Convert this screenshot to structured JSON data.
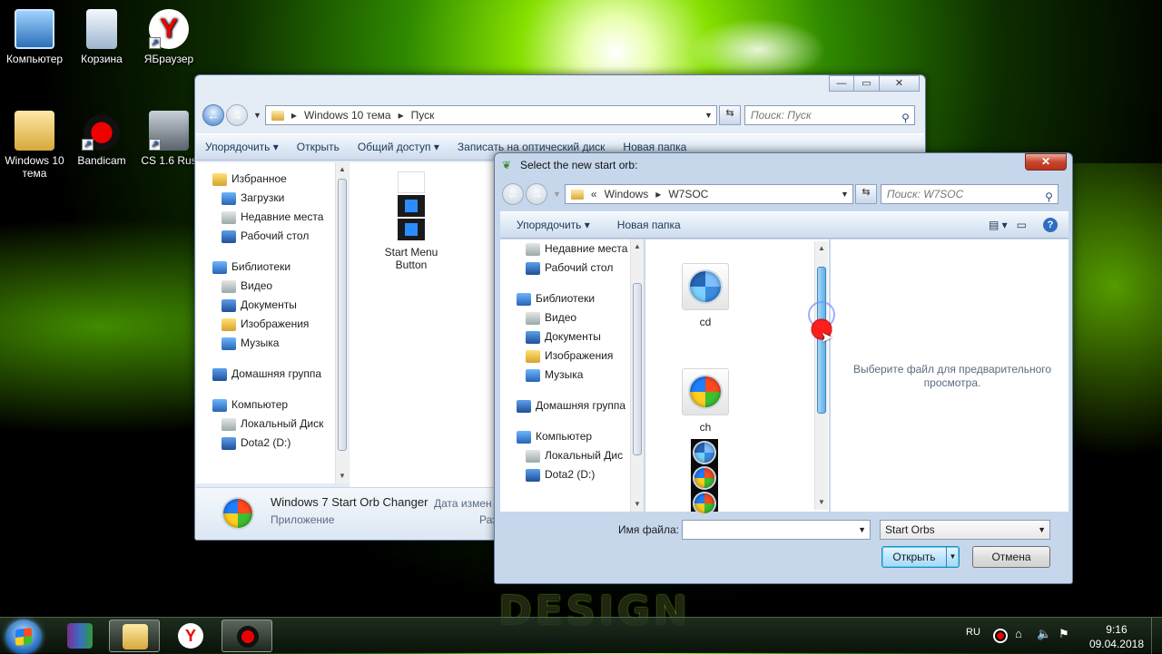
{
  "desktop": {
    "icons": [
      {
        "label": "Компьютер"
      },
      {
        "label": "Корзина"
      },
      {
        "label": "ЯБраузер"
      },
      {
        "label": "Windows 10 тема"
      },
      {
        "label": "Bandicam"
      },
      {
        "label": "CS 1.6 Rus"
      }
    ],
    "wallpaper_text": "DESIGN"
  },
  "explorer": {
    "breadcrumb": [
      "Windows 10 тема",
      "Пуск"
    ],
    "search_placeholder": "Поиск: Пуск",
    "toolbar": [
      "Упорядочить",
      "Открыть",
      "Общий доступ",
      "Записать на оптический диск",
      "Новая папка"
    ],
    "nav": [
      {
        "label": "Избранное",
        "level": 0
      },
      {
        "label": "Загрузки",
        "level": 1
      },
      {
        "label": "Недавние места",
        "level": 1
      },
      {
        "label": "Рабочий стол",
        "level": 1
      },
      {
        "label": "",
        "level": 0
      },
      {
        "label": "Библиотеки",
        "level": 0
      },
      {
        "label": "Видео",
        "level": 1
      },
      {
        "label": "Документы",
        "level": 1
      },
      {
        "label": "Изображения",
        "level": 1
      },
      {
        "label": "Музыка",
        "level": 1
      },
      {
        "label": "",
        "level": 0
      },
      {
        "label": "Домашняя группа",
        "level": 0
      },
      {
        "label": "",
        "level": 0
      },
      {
        "label": "Компьютер",
        "level": 0
      },
      {
        "label": "Локальный Диск",
        "level": 1
      },
      {
        "label": "Dota2  (D:)",
        "level": 1
      }
    ],
    "item": {
      "label": "Start Menu Button"
    },
    "details": {
      "name": "Windows 7 Start Orb Changer",
      "type": "Приложение",
      "date_label": "Дата измен",
      "size_label": "Раз"
    }
  },
  "dialog": {
    "title": "Select the new start orb:",
    "breadcrumb": [
      "Windows",
      "W7SOC"
    ],
    "breadcrumb_prefix": "«",
    "search_placeholder": "Поиск: W7SOC",
    "toolbar": [
      "Упорядочить",
      "Новая папка"
    ],
    "nav": [
      {
        "label": "Недавние места",
        "level": 1
      },
      {
        "label": "Рабочий стол",
        "level": 1
      },
      {
        "label": "",
        "level": 0
      },
      {
        "label": "Библиотеки",
        "level": 0
      },
      {
        "label": "Видео",
        "level": 1
      },
      {
        "label": "Документы",
        "level": 1
      },
      {
        "label": "Изображения",
        "level": 1
      },
      {
        "label": "Музыка",
        "level": 1
      },
      {
        "label": "",
        "level": 0
      },
      {
        "label": "Домашняя группа",
        "level": 0
      },
      {
        "label": "",
        "level": 0
      },
      {
        "label": "Компьютер",
        "level": 0
      },
      {
        "label": "Локальный Дис",
        "level": 1
      },
      {
        "label": "Dota2  (D:)",
        "level": 1
      }
    ],
    "files": [
      {
        "label": "cd"
      },
      {
        "label": "ch"
      }
    ],
    "preview_text": "Выберите файл для предварительного просмотра.",
    "filename_label": "Имя файла:",
    "filename_value": "",
    "filter": "Start Orbs",
    "open_label": "Открыть",
    "cancel_label": "Отмена"
  },
  "taskbar": {
    "lang": "RU",
    "time": "9:16",
    "date": "09.04.2018"
  }
}
